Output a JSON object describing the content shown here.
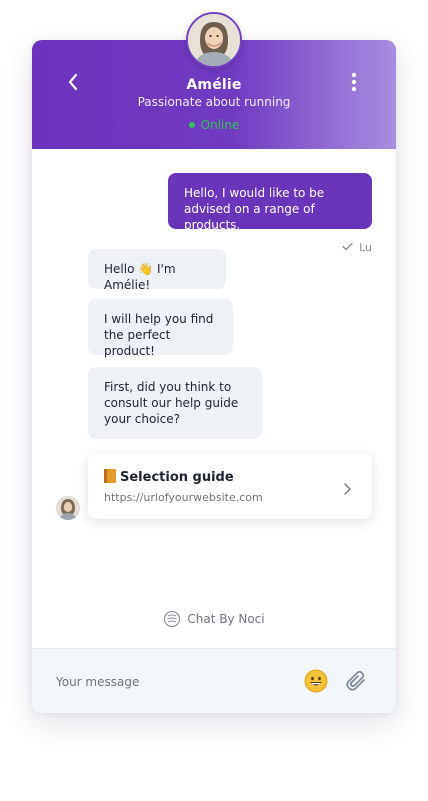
{
  "agent": {
    "name": "Amélie",
    "tagline": "Passionate about running",
    "status": "Online"
  },
  "messages": {
    "outgoing_1": "Hello, I would like to be advised on a range of products.",
    "read_receipt": "Lu",
    "incoming_1": "Hello 👋 I'm Amélie!",
    "incoming_2": "I will help you find the perfect product!",
    "incoming_3": "First, did you think to consult our help guide your choice?"
  },
  "card": {
    "title": "Selection guide",
    "url": "https://urlofyourwebsite.com"
  },
  "footer": {
    "powered_by": "Chat By Noci"
  },
  "composer": {
    "placeholder": "Your message"
  },
  "colors": {
    "accent": "#6936ba",
    "online": "#34c15b",
    "incoming_bubble": "#eef1f5"
  },
  "icons": {
    "back": "chevron-left-icon",
    "more": "more-vertical-icon",
    "emoji": "emoji-icon",
    "attach": "paperclip-icon",
    "card_arrow": "chevron-right-icon"
  }
}
